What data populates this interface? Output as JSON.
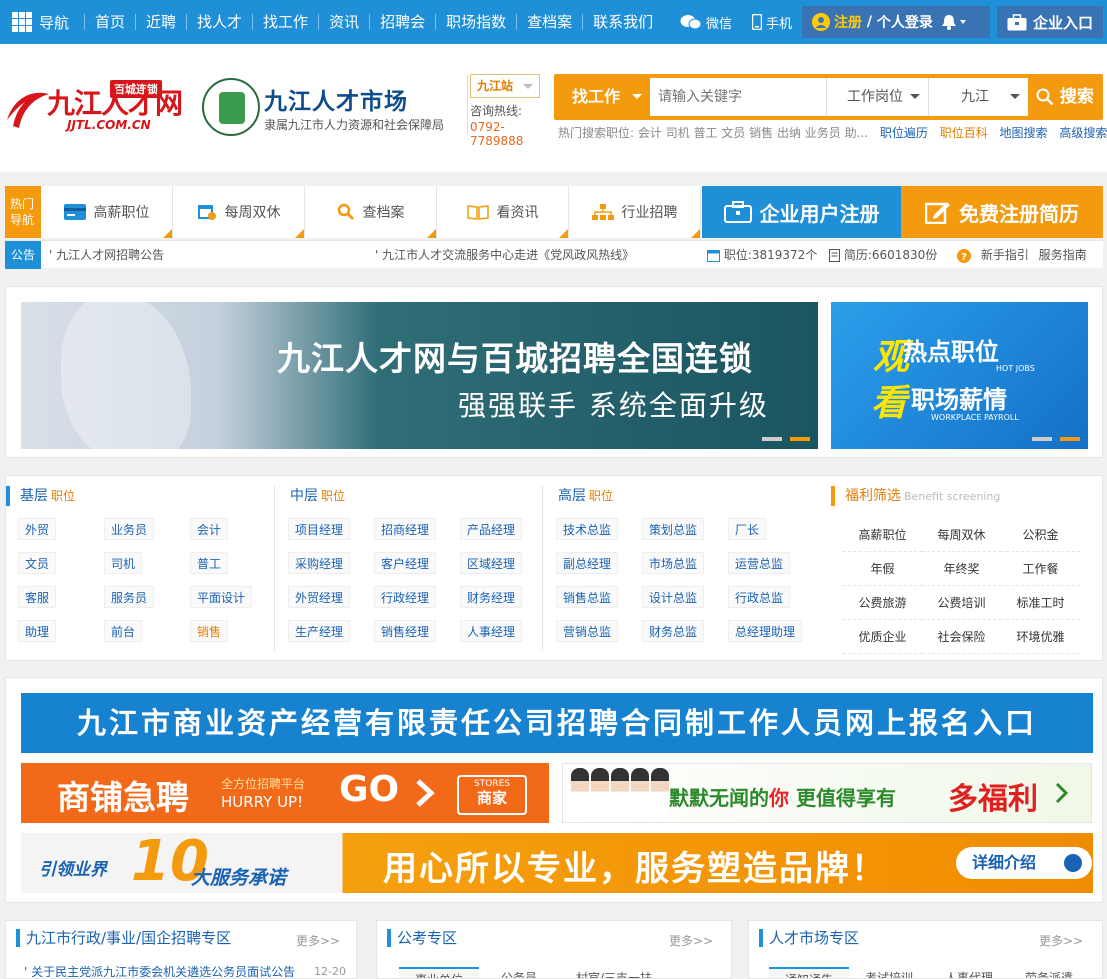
{
  "topbar": {
    "nav_label": "导航",
    "links": [
      "首页",
      "近聘",
      "找人才",
      "找工作",
      "资讯",
      "招聘会",
      "职场指数",
      "查档案",
      "联系我们"
    ],
    "wechat": "微信",
    "mobile": "手机",
    "register": "注册",
    "slash": " / ",
    "login": "个人登录",
    "enterprise": "企业入口"
  },
  "header": {
    "logo1_main": "九江人才网",
    "logo1_badge": "百城连锁",
    "logo1_domain": "JJTL.COM.CN",
    "logo2_title": "九江人才市场",
    "logo2_sub": "隶属九江市人力资源和社会保障局",
    "site": "九江站",
    "hotline_label": "咨询热线:",
    "hotline": "0792-7789888",
    "search_type": "找工作",
    "search_placeholder": "请输入关键字",
    "dropdown_position": "工作岗位",
    "dropdown_city": "九江",
    "search_button": "搜索",
    "hot_label": "热门搜索职位:",
    "hot_words": "会计 司机 普工 文员 销售 出纳 业务员 助...",
    "links": [
      "职位遍历",
      "职位百科",
      "地图搜索",
      "高级搜索"
    ]
  },
  "navtiles": {
    "hot_label": "热门导航",
    "tiles": [
      "高薪职位",
      "每周双休",
      "查档案",
      "看资讯",
      "行业招聘"
    ],
    "enterprise_register": "企业用户注册",
    "resume_register": "免费注册简历"
  },
  "notice": {
    "label": "公告",
    "items": [
      "' 九江人才网招聘公告",
      "' 九江市人才交流服务中心走进《党风政风热线》"
    ],
    "jobs": "职位:3819372个",
    "resumes": "简历:6601830份",
    "guide": "新手指引",
    "service": "服务指南"
  },
  "banners": {
    "main_line1": "九江人才网与百城招聘全国连锁",
    "main_line2": "强强联手 系统全面升级",
    "side_y1": "观",
    "side_y2": "看",
    "side_t1": "热点职位",
    "side_t2": "职场薪情",
    "side_s1": "HOT JOBS",
    "side_s2": "WORKPLACE PAYROLL"
  },
  "categories": {
    "basic_title": "基层",
    "mid_title": "中层",
    "high_title": "高层",
    "suffix": "职位",
    "basic": [
      "外贸",
      "业务员",
      "会计",
      "文员",
      "司机",
      "普工",
      "客服",
      "服务员",
      "平面设计",
      "助理",
      "前台",
      "销售"
    ],
    "mid": [
      "项目经理",
      "招商经理",
      "产品经理",
      "采购经理",
      "客户经理",
      "区域经理",
      "外贸经理",
      "行政经理",
      "财务经理",
      "生产经理",
      "销售经理",
      "人事经理"
    ],
    "high": [
      "技术总监",
      "策划总监",
      "厂长",
      "副总经理",
      "市场总监",
      "运营总监",
      "销售总监",
      "设计总监",
      "行政总监",
      "营销总监",
      "财务总监",
      "总经理助理"
    ],
    "welfare_title": "福利筛选",
    "welfare_en": "Benefit screening",
    "welfare": [
      "高薪职位",
      "每周双休",
      "公积金",
      "年假",
      "年终奖",
      "工作餐",
      "公费旅游",
      "公费培训",
      "标准工时",
      "优质企业",
      "社会保险",
      "环境优雅"
    ]
  },
  "ads": {
    "ad1": "九江市商业资产经营有限责任公司招聘合同制工作人员网上报名入口",
    "ad2_main": "商铺急聘",
    "ad2_sub1": "全方位招聘平台",
    "ad2_sub2": "HURRY UP!",
    "ad2_go": "GO",
    "ad2_stores": "STORES",
    "ad2_shop": "商家",
    "ad3_pre": "默默无闻的",
    "ad3_you": "你",
    "ad3_mid": " 更值得享有",
    "ad3_big": "多福利",
    "ad4_lead": "引领业界",
    "ad4_ten": "10",
    "ad4_promise": "大服务承诺",
    "ad4_slogan": "用心所以专业，服务塑造品牌！",
    "ad4_btn": "详细介绍"
  },
  "boxes": {
    "b1_title": "九江市行政/事业/国企招聘专区",
    "b1_more": "更多>>",
    "b1_item": "' 关于民主党派九江市委会机关遴选公务员面试公告",
    "b1_date": "12-20",
    "b2_title": "公考专区",
    "b2_more": "更多>>",
    "b2_tabs": [
      "事业单位",
      "公务员",
      "村官/三支一扶"
    ],
    "b3_title": "人才市场专区",
    "b3_more": "更多>>",
    "b3_tabs": [
      "通知通告",
      "考试培训",
      "人事代理",
      "劳务派遣"
    ]
  },
  "colors": {
    "primary": "#1f8fd8",
    "accent": "#f39a0e",
    "link": "#1a62b3"
  }
}
